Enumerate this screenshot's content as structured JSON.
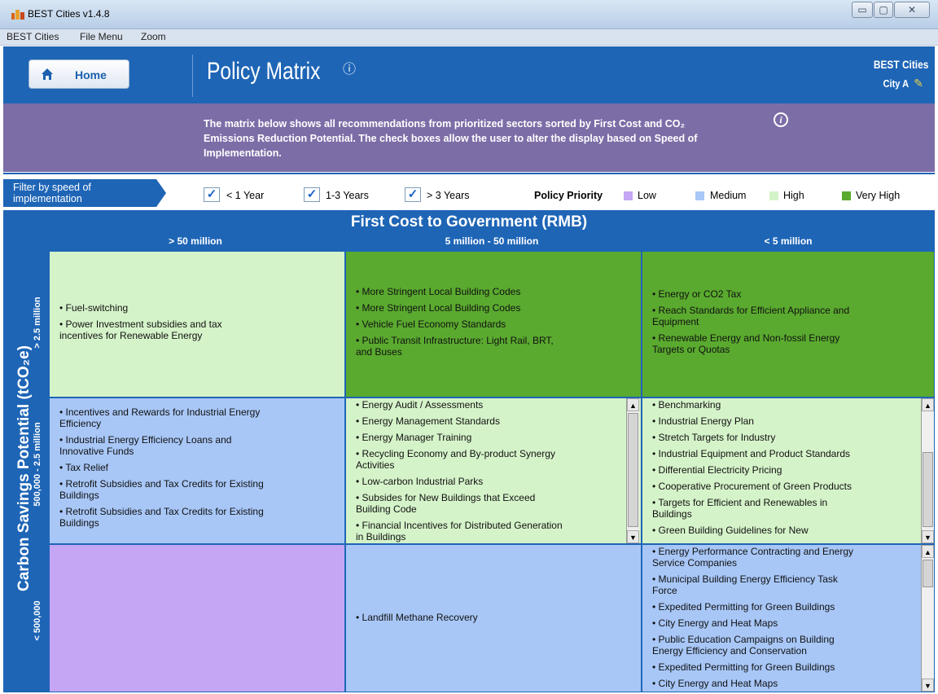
{
  "window": {
    "title": "BEST Cities v1.4.8"
  },
  "menu": [
    "BEST Cities",
    "File Menu",
    "Zoom"
  ],
  "header": {
    "home_label": "Home",
    "title": "Policy Matrix",
    "help": "?",
    "brand": "BEST Cities",
    "city": "City A"
  },
  "description": {
    "line1": "The matrix below shows all recommendations from prioritized sectors sorted by First Cost and CO₂",
    "line2": "Emissions Reduction Potential. The check boxes allow the user to alter the display based on Speed of",
    "line3": "Implementation.",
    "info": "i"
  },
  "filter": {
    "label": "Filter by speed of implementation",
    "options": [
      {
        "label": "< 1 Year",
        "checked": true
      },
      {
        "label": "1-3 Years",
        "checked": true
      },
      {
        "label": "> 3 Years",
        "checked": true
      }
    ]
  },
  "priority": {
    "label": "Policy Priority",
    "levels": [
      {
        "label": "Low",
        "color": "#c5a6f5"
      },
      {
        "label": "Medium",
        "color": "#a8c7f7"
      },
      {
        "label": "High",
        "color": "#d5f3c9"
      },
      {
        "label": "Very High",
        "color": "#5aaa2f"
      }
    ]
  },
  "matrix": {
    "col_title": "First Cost to Government (RMB)",
    "columns": [
      "> 50 million",
      "5 million - 50 million",
      "< 5 million"
    ],
    "row_title": "Carbon Savings Potential (tCO₂e)",
    "rows": [
      "> 2.5 million",
      "500,000 - 2.5 million",
      "< 500,000"
    ],
    "cells": {
      "r0c0": [
        "• Fuel-switching",
        "• Power Investment subsidies and tax incentives for Renewable Energy"
      ],
      "r0c1": [
        "• More Stringent Local Building Codes",
        "• More Stringent Local Building Codes",
        "• Vehicle Fuel Economy Standards",
        "• Public Transit Infrastructure: Light Rail, BRT, and Buses"
      ],
      "r0c2": [
        "• Energy or CO2 Tax",
        "• Reach Standards for Efficient Appliance and Equipment",
        "• Renewable Energy and Non-fossil Energy Targets or Quotas"
      ],
      "r1c0": [
        "• Incentives and Rewards for Industrial Energy Efficiency",
        "• Industrial Energy Efficiency Loans and Innovative Funds",
        "• Tax Relief",
        "• Retrofit Subsidies and Tax Credits for Existing Buildings",
        "• Retrofit Subsidies and Tax Credits for Existing Buildings"
      ],
      "r1c1": [
        "• Energy Audit / Assessments",
        "• Energy Management Standards",
        "• Energy Manager Training",
        "• Recycling Economy and By-product Synergy Activities",
        "• Low-carbon Industrial Parks",
        "• Subsides for New Buildings that Exceed Building Code",
        "• Financial Incentives for Distributed Generation in Buildings"
      ],
      "r1c2": [
        "• Benchmarking",
        "• Industrial Energy Plan",
        "• Stretch Targets for Industry",
        "• Industrial Equipment and Product Standards",
        "• Differential Electricity Pricing",
        "• Cooperative Procurement of Green Products",
        "• Targets for Efficient and Renewables in Buildings",
        "• Green Building Guidelines for New"
      ],
      "r2c0": [],
      "r2c1": [
        "• Landfill Methane Recovery"
      ],
      "r2c2": [
        "• Energy Performance Contracting and Energy Service Companies",
        "• Municipal Building Energy Efficiency Task Force",
        "• Expedited Permitting for Green Buildings",
        "• City Energy and Heat Maps",
        "• Public Education Campaigns on Building Energy Efficiency and Conservation",
        "• Expedited Permitting for Green Buildings",
        "• City Energy and Heat Maps"
      ]
    }
  }
}
